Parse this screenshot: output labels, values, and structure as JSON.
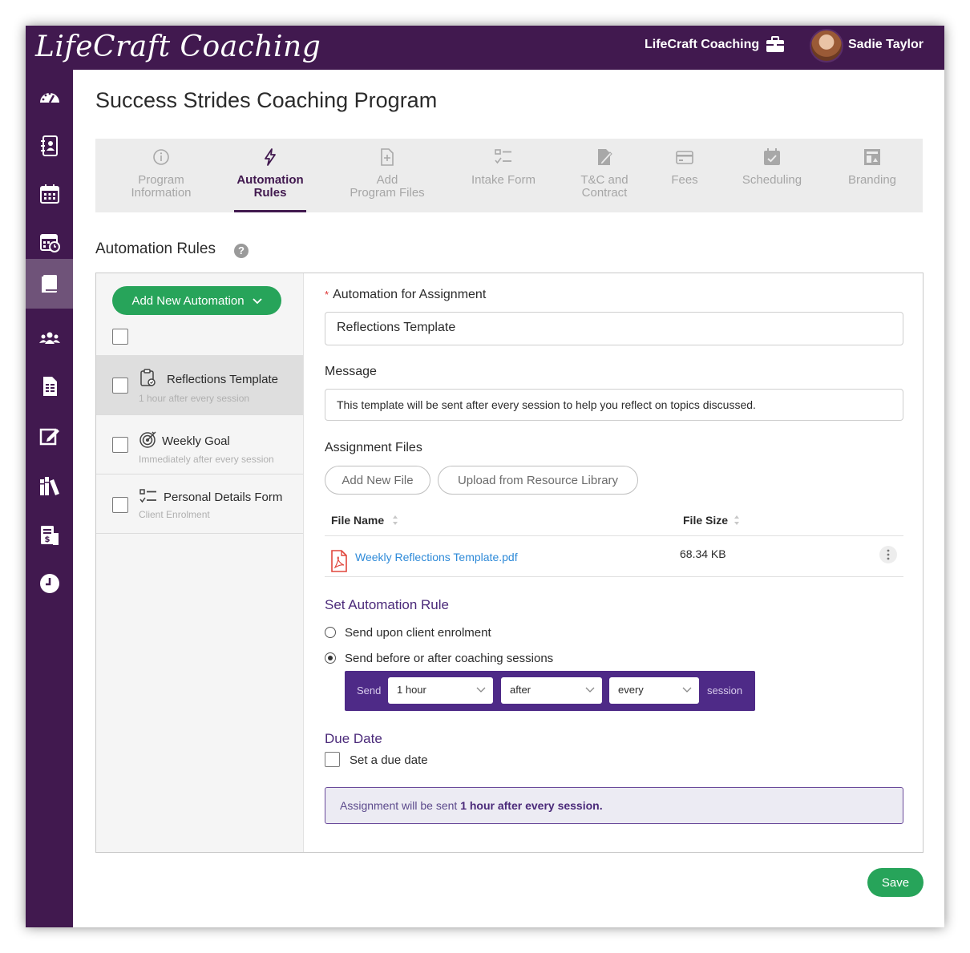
{
  "app": {
    "logo_text": "LifeCraft Coaching",
    "brand_name": "LifeCraft Coaching",
    "user_name": "Sadie Taylor"
  },
  "colors": {
    "primary": "#41194f",
    "accent_green": "#27a45a",
    "link_blue": "#2e8ad8",
    "rule_bar": "#4e2a87"
  },
  "sidebar": {
    "items": [
      {
        "icon": "dashboard-icon",
        "active": false
      },
      {
        "icon": "contacts-book-icon",
        "active": false
      },
      {
        "icon": "calendar-icon",
        "active": false
      },
      {
        "icon": "calendar-clock-icon",
        "active": false
      },
      {
        "icon": "programs-book-icon",
        "active": true
      },
      {
        "icon": "clients-group-icon",
        "active": false
      },
      {
        "icon": "documents-icon",
        "active": false
      },
      {
        "icon": "edit-form-icon",
        "active": false
      },
      {
        "icon": "library-icon",
        "active": false
      },
      {
        "icon": "invoice-icon",
        "active": false
      },
      {
        "icon": "clock-icon",
        "active": false
      }
    ]
  },
  "page": {
    "title": "Success Strides Coaching Program"
  },
  "tabs": [
    {
      "label": "Program\nInformation",
      "icon": "info-icon",
      "active": false
    },
    {
      "label": "Automation\nRules",
      "icon": "lightning-icon",
      "active": true
    },
    {
      "label": "Add\nProgram Files",
      "icon": "add-file-icon",
      "active": false
    },
    {
      "label": "Intake Form",
      "icon": "checklist-icon",
      "active": false
    },
    {
      "label": "T&C and\nContract",
      "icon": "signature-icon",
      "active": false
    },
    {
      "label": "Fees",
      "icon": "card-icon",
      "active": false
    },
    {
      "label": "Scheduling",
      "icon": "calendar-check-icon",
      "active": false
    },
    {
      "label": "Branding",
      "icon": "branding-icon",
      "active": false
    }
  ],
  "automation": {
    "section_title": "Automation Rules",
    "add_button": "Add New Automation",
    "list": [
      {
        "title": "Reflections Template",
        "subtitle": "1 hour after every session",
        "icon": "clipboard-icon",
        "selected": true
      },
      {
        "title": "Weekly Goal",
        "subtitle": "Immediately after every session",
        "icon": "target-icon",
        "selected": false
      },
      {
        "title": "Personal Details Form",
        "subtitle": "Client Enrolment",
        "icon": "checklist-icon",
        "selected": false
      }
    ]
  },
  "form": {
    "assignment_label": "Automation for Assignment",
    "assignment_value": "Reflections Template",
    "message_label": "Message",
    "message_value": "This template will be sent after every session to help you reflect on topics discussed.",
    "files_label": "Assignment Files",
    "add_file_button": "Add New File",
    "upload_button": "Upload from Resource Library",
    "table": {
      "col_name": "File Name",
      "col_size": "File Size",
      "rows": [
        {
          "name": "Weekly Reflections Template.pdf",
          "size": "68.34 KB"
        }
      ]
    },
    "rule_heading": "Set Automation Rule",
    "options": [
      {
        "label": "Send upon client enrolment",
        "checked": false
      },
      {
        "label": "Send before or after coaching sessions",
        "checked": true
      }
    ],
    "rule": {
      "send": "Send",
      "time": "1 hour",
      "when": "after",
      "freq": "every",
      "unit": "session"
    },
    "due_heading": "Due Date",
    "due_checkbox": "Set a due date",
    "summary_prefix": "Assignment will be sent ",
    "summary_bold": "1 hour after every session."
  },
  "actions": {
    "save": "Save"
  }
}
